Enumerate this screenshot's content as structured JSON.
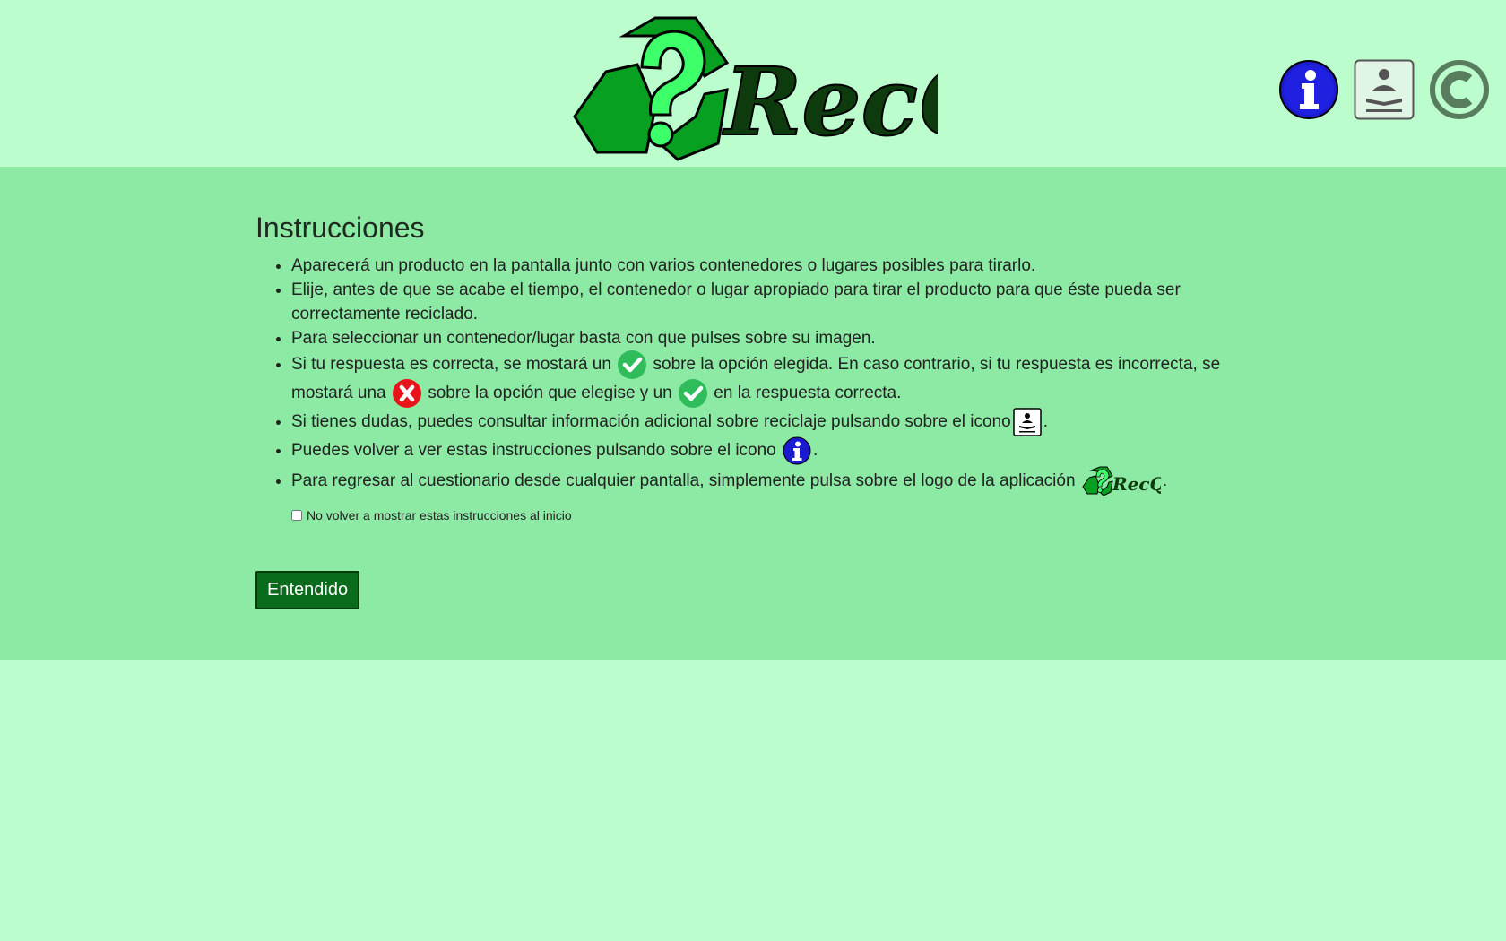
{
  "app": {
    "logo_text": "RecQuiz"
  },
  "header_icons": [
    "info-icon",
    "guide-reading-icon",
    "copyright-icon"
  ],
  "instructions": {
    "title": "Instrucciones",
    "items": {
      "0": "Aparecerá un producto en la pantalla junto con varios contenedores o lugares posibles para tirarlo.",
      "1": "Elije, antes de que se acabe el tiempo, el contenedor o lugar apropiado para tirar el producto para que éste pueda ser correctamente reciclado.",
      "2": "Para seleccionar un contenedor/lugar basta con que pulses sobre su imagen.",
      "3": {
        "a": "Si tu respuesta es correcta, se mostará un",
        "b": "sobre la opción elegida. En caso contrario, si tu respuesta es incorrecta, se mostará una",
        "c": "sobre la opción que elegise y un",
        "d": "en la respuesta correcta."
      },
      "4": {
        "a": "Si tienes dudas, puedes consultar información adicional sobre reciclaje pulsando sobre el icono",
        "b": "."
      },
      "5": {
        "a": "Puedes volver a ver estas instrucciones pulsando sobre el icono",
        "b": "."
      },
      "6": {
        "a": "Para regresar al cuestionario desde cualquier pantalla, simplemente pulsa sobre el logo de la aplicación",
        "b": "."
      }
    },
    "checkbox_label": "No volver a mostrar estas instrucciones al inicio",
    "checkbox_checked": false,
    "button_label": "Entendido"
  },
  "colors": {
    "page_bg": "#bbfdcd",
    "panel_bg": "#8deaa5",
    "button_bg": "#0a6b1c",
    "correct": "#2ebd5a",
    "incorrect": "#e8141a",
    "info": "#1a1ad0"
  }
}
